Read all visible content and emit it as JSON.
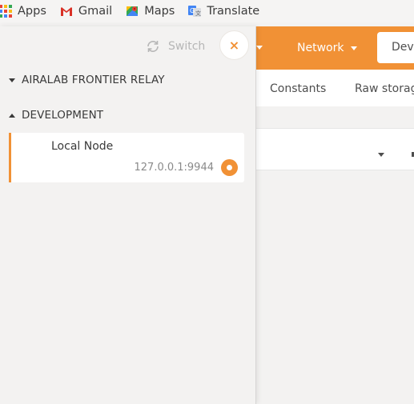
{
  "bookmarks": [
    {
      "label": "Apps",
      "icon": "apps-grid-icon"
    },
    {
      "label": "Gmail",
      "icon": "gmail-icon"
    },
    {
      "label": "Maps",
      "icon": "maps-icon"
    },
    {
      "label": "Translate",
      "icon": "translate-icon"
    }
  ],
  "topnav": {
    "network_label": "Network",
    "dev_tab_label": "Developer"
  },
  "subtabs": [
    "Constants",
    "Raw storage"
  ],
  "sidebar": {
    "switch_label": "Switch",
    "close_symbol": "×",
    "groups": [
      {
        "label": "AIRALAB FRONTIER RELAY",
        "expanded": false
      },
      {
        "label": "DEVELOPMENT",
        "expanded": true
      }
    ],
    "endpoint": {
      "name": "Local Node",
      "url": "127.0.0.1:9944",
      "selected": true
    }
  },
  "colors": {
    "accent": "#f19135",
    "background": "#f3f2f1"
  }
}
